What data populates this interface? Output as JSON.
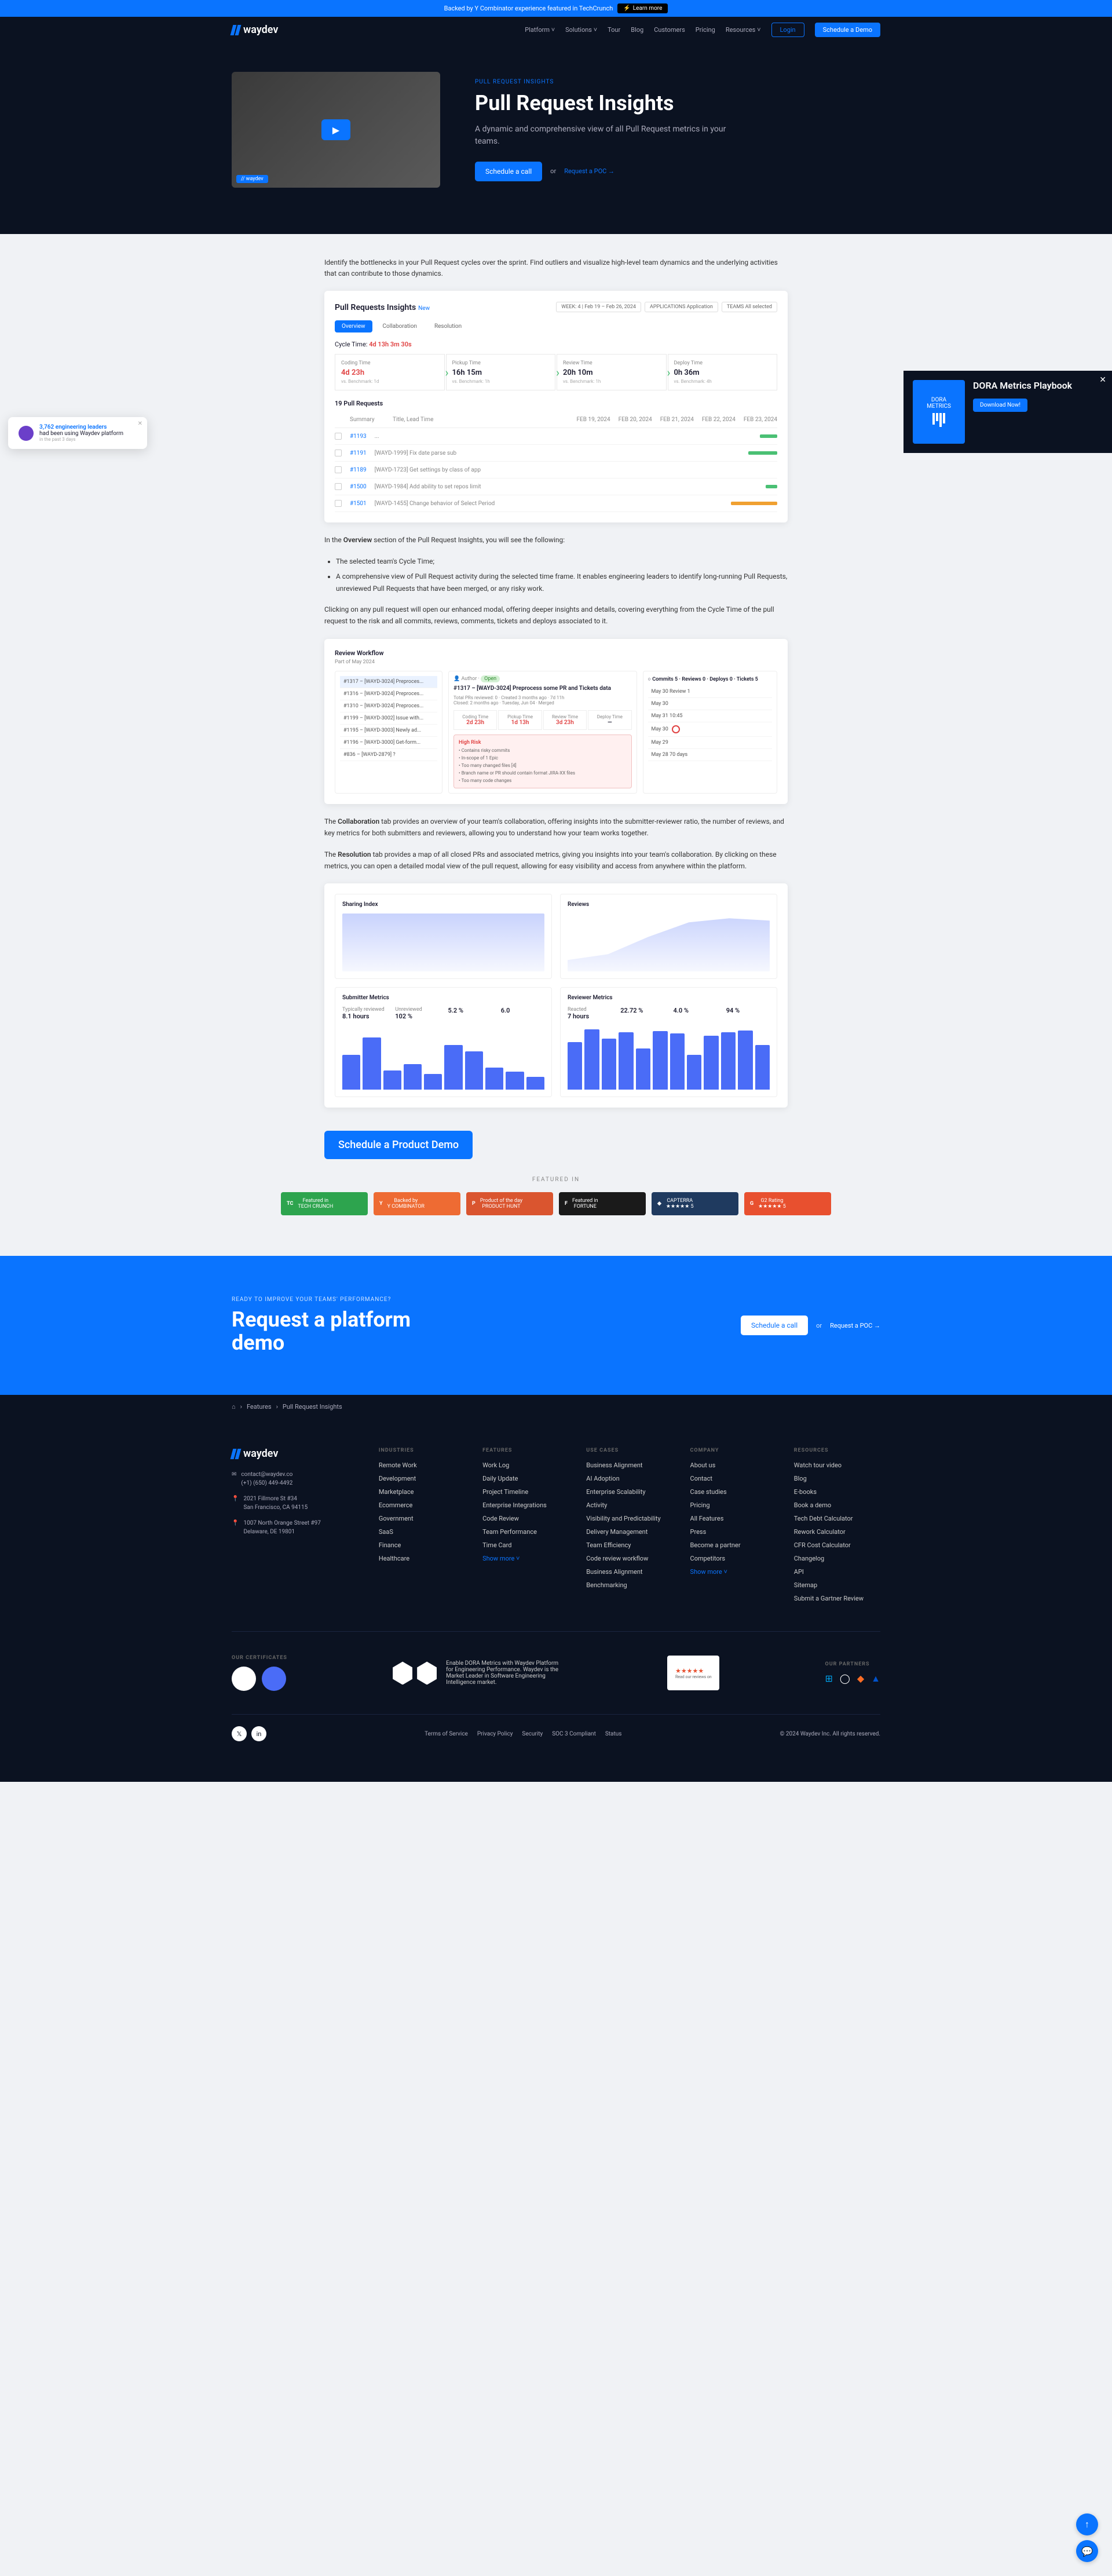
{
  "announce": {
    "text": "Backed by Y Combinator experience featured in TechCrunch",
    "btn": "Learn more"
  },
  "nav": {
    "brand": "waydev",
    "links": [
      "Platform",
      "Solutions",
      "Tour",
      "Blog",
      "Customers",
      "Pricing",
      "Resources"
    ],
    "login": "Login",
    "demo": "Schedule a Demo"
  },
  "hero": {
    "eyebrow": "PULL REQUEST INSIGHTS",
    "title": "Pull Request Insights",
    "desc": "A dynamic and comprehensive view of all Pull Request metrics in your teams.",
    "cta": "Schedule a call",
    "or": "or",
    "poc": "Request a POC →"
  },
  "intro": "Identify the bottlenecks in your Pull Request cycles over the sprint. Find outliers and visualize high-level team dynamics and the underlying activities that can contribute to those dynamics.",
  "ss1": {
    "title": "Pull Requests Insights",
    "new": "New",
    "week": "WEEK: 4 | Feb 19 – Feb 26, 2024",
    "apps": "APPLICATIONS Application",
    "teams": "TEAMS All selected",
    "tabs": [
      "Overview",
      "Collaboration",
      "Resolution"
    ],
    "cycle_label": "Cycle Time:",
    "cycle_val": "4d 13h 3m 30s",
    "stages": [
      {
        "label": "Coding Time",
        "val": "4d 23h",
        "bench": "vs. Benchmark: 1d"
      },
      {
        "label": "Pickup Time",
        "val": "16h 15m",
        "bench": "vs. Benchmark: 1h"
      },
      {
        "label": "Review Time",
        "val": "20h 10m",
        "bench": "vs. Benchmark: 1h"
      },
      {
        "label": "Deploy Time",
        "val": "0h 36m",
        "bench": "vs. Benchmark: 4h"
      }
    ],
    "pr_count": "19 Pull Requests",
    "cols": [
      "Summary",
      "Title, Lead Time",
      "FEB 19, 2024",
      "FEB 20, 2024",
      "FEB 21, 2024",
      "FEB 22, 2024",
      "FEB 23, 2024"
    ]
  },
  "overview_intro": "In the Overview section of the Pull Request Insights, you will see the following:",
  "bullets": [
    "The selected team's Cycle Time;",
    "A comprehensive view of Pull Request activity during the selected time frame. It enables engineering leaders to identify long-running Pull Requests, unreviewed Pull Requests that have been merged, or any risky work."
  ],
  "para2": "Clicking on any pull request will open our enhanced modal, offering deeper insights and details, covering everything from the Cycle Time of the pull request to the risk and all commits, reviews, comments, tickets and deploys associated to it.",
  "ss2": {
    "title": "Review Workflow",
    "period": "Part of   May 2024",
    "items": [
      "#1317 – [WAYD-3024] Preproces...",
      "#1316 – [WAYD-3024] Preproces...",
      "#1310 – [WAYD-3024] Preproces...",
      "#1199 – [WAYD-3002] Issue with...",
      "#1195 – [WAYD-3003] Newly ad...",
      "#1196 – [WAYD-3000] Get-form...",
      "#836 – [WAYD-2879] ?"
    ],
    "author": "Author",
    "status": "Open",
    "pr_title": "#1317 – [WAYD-3024] Preprocess some PR and Tickets data",
    "stages": [
      {
        "l": "Coding Time",
        "v": "2d 23h"
      },
      {
        "l": "Pickup Time",
        "v": "1d 13h"
      },
      {
        "l": "Review Time",
        "v": "3d 23h"
      },
      {
        "l": "Deploy Time",
        "v": "—"
      }
    ],
    "risk_title": "High Risk",
    "risks": [
      "Contains risky commits",
      "In-scope of 1 Epic",
      "Too many changed files [4]",
      "Branch name or PR should contain format JIRA-XX files",
      "Too many code changes"
    ],
    "commits_label": "Commits",
    "events": [
      "May 30  Review 1",
      "May 30",
      "May 31  10:45",
      "May 30",
      "May 29",
      "May 28  70 days"
    ]
  },
  "collab_text": "The Collaboration tab provides an overview of your team's collaboration, offering insights into the submitter-reviewer ratio, the number of reviews, and key metrics for both submitters and reviewers, allowing you to understand how your team works together.",
  "resolution_text": "The Resolution tab provides a map of all closed PRs and associated metrics, giving you insights into your team's collaboration. By clicking on these metrics, you can open a detailed modal view of the pull request, allowing for easy visibility and access from anywhere within the platform.",
  "ss3": {
    "chart1": "Sharing Index",
    "chart2": "Reviews",
    "sub_metrics_title": "Submitter Metrics",
    "rev_metrics_title": "Reviewer Metrics",
    "metrics1": [
      {
        "l": "Typically reviewed",
        "v": "8.1 hours"
      },
      {
        "l": "Unreviewed",
        "v": "102 %"
      },
      {
        "l": "",
        "v": "5.2 %"
      },
      {
        "l": "",
        "v": "6.0"
      }
    ],
    "metrics2": [
      {
        "l": "Reacted",
        "v": "7 hours"
      },
      {
        "l": "",
        "v": "22.72 %"
      },
      {
        "l": "",
        "v": "4.0 %"
      },
      {
        "l": "",
        "v": "94 %"
      }
    ]
  },
  "chart_data": [
    {
      "type": "area",
      "title": "Sharing Index",
      "x": [
        1,
        2,
        3,
        4,
        5,
        6,
        7,
        8,
        9,
        10
      ],
      "y": [
        220,
        210,
        205,
        200,
        198,
        195,
        190,
        188,
        185,
        180
      ],
      "ylim": [
        0,
        300
      ]
    },
    {
      "type": "area",
      "title": "Reviews",
      "x": [
        1,
        2,
        3,
        4,
        5,
        6,
        7,
        8,
        9,
        10
      ],
      "y": [
        40,
        50,
        70,
        110,
        160,
        200,
        220,
        225,
        220,
        210
      ],
      "ylim": [
        0,
        300
      ]
    },
    {
      "type": "bar",
      "title": "Submitter Metrics",
      "categories": [
        "1",
        "2",
        "3",
        "4",
        "5",
        "6",
        "7",
        "8",
        "9",
        "10"
      ],
      "values": [
        55,
        82,
        30,
        40,
        25,
        70,
        60,
        35,
        28,
        20
      ]
    },
    {
      "type": "bar",
      "title": "Reviewer Metrics",
      "categories": [
        "1",
        "2",
        "3",
        "4",
        "5",
        "6",
        "7",
        "8",
        "9",
        "10",
        "11",
        "12"
      ],
      "values": [
        75,
        95,
        80,
        90,
        65,
        92,
        88,
        55,
        85,
        90,
        93,
        70
      ]
    }
  ],
  "product_demo": "Schedule a Product Demo",
  "featured_label": "FEATURED IN",
  "badges": [
    {
      "line1": "Featured in",
      "line2": "TECH CRUNCH"
    },
    {
      "line1": "Backed by",
      "line2": "Y COMBINATOR"
    },
    {
      "line1": "Product of the day",
      "line2": "PRODUCT HUNT"
    },
    {
      "line1": "Featured in",
      "line2": "FORTUNE"
    },
    {
      "line1": "CAPTERRA",
      "line2": "★★★★★  5"
    },
    {
      "line1": "G2 Rating",
      "line2": "★★★★★  5"
    }
  ],
  "cta": {
    "eyebrow": "READY TO IMPROVE YOUR TEAMS' PERFORMANCE?",
    "title": "Request a platform demo",
    "btn": "Schedule a call",
    "or": "or",
    "poc": "Request a POC →"
  },
  "breadcrumb": {
    "home": "⌂",
    "l1": "Features",
    "l2": "Pull Request Insights"
  },
  "footer": {
    "brand": "waydev",
    "contact": {
      "email": "contact@waydev.co",
      "phone": "(+1) (650) 449-4492",
      "addr1": "2021 Fillmore St #34\nSan Francisco, CA 94115",
      "addr2": "1007 North Orange Street #97\nDelaware, DE 19801"
    },
    "cols": {
      "industries": {
        "h": "INDUSTRIES",
        "links": [
          "Remote Work",
          "Development",
          "Marketplace",
          "Ecommerce",
          "Government",
          "SaaS",
          "Finance",
          "Healthcare"
        ]
      },
      "features": {
        "h": "FEATURES",
        "links": [
          "Work Log",
          "Daily Update",
          "Project Timeline",
          "Enterprise Integrations",
          "Code Review",
          "Team Performance",
          "Time Card"
        ],
        "show": "Show more ˅"
      },
      "usecases": {
        "h": "USE CASES",
        "links": [
          "Business Alignment",
          "AI Adoption",
          "Enterprise Scalability",
          "Activity",
          "Visibility and Predictability",
          "Delivery Management",
          "Team Efficiency",
          "Code review workflow",
          "Business Alignment",
          "Benchmarking"
        ]
      },
      "company": {
        "h": "COMPANY",
        "links": [
          "About us",
          "Contact",
          "Case studies",
          "Pricing",
          "All Features",
          "Press",
          "Become a partner",
          "Competitors"
        ],
        "show": "Show more ˅"
      },
      "resources": {
        "h": "RESOURCES",
        "links": [
          "Watch tour video",
          "Blog",
          "E-books",
          "Book a demo",
          "Tech Debt Calculator",
          "Rework Calculator",
          "CFR Cost Calculator",
          "Changelog",
          "API",
          "Sitemap",
          "Submit a Gartner Review"
        ]
      }
    },
    "cert_label": "OUR CERTIFICATES",
    "partners_label": "OUR PARTNERS",
    "about_text": "Enable DORA Metrics with Waydev Platform for Engineering Performance. Waydev is the Market Leader in Software Engineering Intelligence market.",
    "legal": [
      "Terms of Service",
      "Privacy Policy",
      "Security",
      "SOC 3 Compliant",
      "Status"
    ],
    "copyright": "© 2024 Waydev Inc. All rights reserved."
  },
  "dora": {
    "title": "DORA Metrics Playbook",
    "btn": "Download Now!",
    "img": "DORA\nMETRICS"
  },
  "toast": {
    "count": "3,762 engineering leaders",
    "text": "had been using Waydev platform",
    "sub": "in the past 3 days"
  }
}
